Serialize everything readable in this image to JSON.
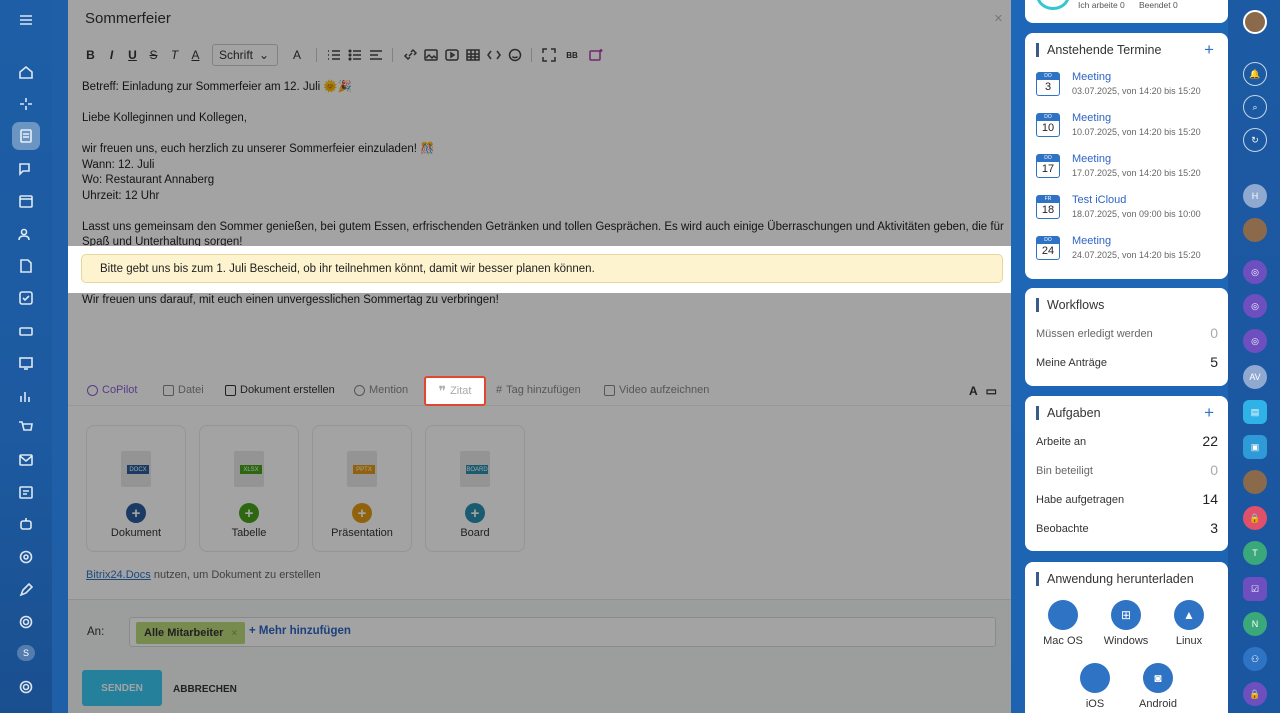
{
  "left_rail": {
    "icons": [
      "menu-icon",
      "home-icon",
      "sparkle-icon",
      "feed-icon",
      "chat-icon",
      "calendar-icon",
      "users-icon",
      "document-icon",
      "check-icon",
      "drive-icon",
      "video-icon",
      "chart-icon",
      "cart-icon",
      "mail-icon",
      "planner-icon",
      "robot-icon",
      "target-icon",
      "edit-icon",
      "support-icon",
      "settings-icon"
    ],
    "badge": "S"
  },
  "editor": {
    "title": "Sommerfeier",
    "toolbar": {
      "font_select": "Schrift",
      "font_size_label": "A"
    },
    "lines": {
      "subject": "Betreff: Einladung zur Sommerfeier am 12. Juli 🌞🎉",
      "greeting": "Liebe Kolleginnen und Kollegen,",
      "intro": "wir freuen uns, euch herzlich zu unserer Sommerfeier einzuladen! 🎊",
      "when": "Wann: 12. Juli",
      "where": "Wo: Restaurant Annaberg",
      "time": "Uhrzeit: 12 Uhr",
      "paragraph": "Lasst uns gemeinsam den Sommer genießen, bei gutem Essen, erfrischenden Getränken und tollen Gesprächen. Es wird auch einige Überraschungen und Aktivitäten geben, die für Spaß und Unterhaltung sorgen!",
      "quote": "Bitte gebt uns bis zum 1. Juli Bescheid, ob ihr teilnehmen könnt, damit wir besser planen können.",
      "closing": "Wir freuen uns darauf, mit euch einen unvergesslichen Sommertag zu verbringen!"
    },
    "panel": {
      "copilot": "CoPilot",
      "datei": "Datei",
      "dokument": "Dokument erstellen",
      "mention": "Mention",
      "zitat": "Zitat",
      "tag": "Tag hinzufügen",
      "video": "Video aufzeichnen",
      "font_btn": "A"
    },
    "docs": [
      {
        "tag": "DOCX",
        "label": "Dokument",
        "color": "#2a5d9c"
      },
      {
        "tag": "XLSX",
        "label": "Tabelle",
        "color": "#47a31a"
      },
      {
        "tag": "PPTX",
        "label": "Präsentation",
        "color": "#e39a13"
      },
      {
        "tag": "BOARD",
        "label": "Board",
        "color": "#2b8fb0"
      }
    ],
    "docs_hint_link": "Bitrix24.Docs",
    "docs_hint_text": " nutzen, um Dokument zu erstellen",
    "recipients": {
      "label": "An:",
      "chip": "Alle Mitarbeiter",
      "chip_remove": "×",
      "more": "+ Mehr hinzufügen"
    },
    "send": "SENDEN",
    "cancel": "ABBRECHEN"
  },
  "right": {
    "top_status": {
      "working": "Ich arbeite 0",
      "finished": "Beendet 0"
    },
    "termine": {
      "title": "Anstehende Termine",
      "add": "+",
      "events": [
        {
          "dow": "DO",
          "day": "3",
          "title": "Meeting",
          "when": "03.07.2025, von 14:20 bis 15:20"
        },
        {
          "dow": "DO",
          "day": "10",
          "title": "Meeting",
          "when": "10.07.2025, von 14:20 bis 15:20"
        },
        {
          "dow": "DO",
          "day": "17",
          "title": "Meeting",
          "when": "17.07.2025, von 14:20 bis 15:20"
        },
        {
          "dow": "FR",
          "day": "18",
          "title": "Test iCloud",
          "when": "18.07.2025, von 09:00 bis 10:00"
        },
        {
          "dow": "DO",
          "day": "24",
          "title": "Meeting",
          "when": "24.07.2025, von 14:20 bis 15:20"
        }
      ]
    },
    "workflows": {
      "title": "Workflows",
      "rows": [
        {
          "label": "Müssen erledigt werden",
          "value": "0"
        },
        {
          "label": "Meine Anträge",
          "value": "5"
        }
      ]
    },
    "aufgaben": {
      "title": "Aufgaben",
      "add": "+",
      "rows": [
        {
          "label": "Arbeite an",
          "value": "22"
        },
        {
          "label": "Bin beteiligt",
          "value": "0"
        },
        {
          "label": "Habe aufgetragen",
          "value": "14"
        },
        {
          "label": "Beobachte",
          "value": "3"
        }
      ]
    },
    "download": {
      "title": "Anwendung herunterladen",
      "apps": [
        "Mac OS",
        "Windows",
        "Linux",
        "iOS",
        "Android"
      ]
    }
  },
  "right_rail": {
    "letters": [
      "H",
      "AV",
      "T",
      "N"
    ]
  }
}
